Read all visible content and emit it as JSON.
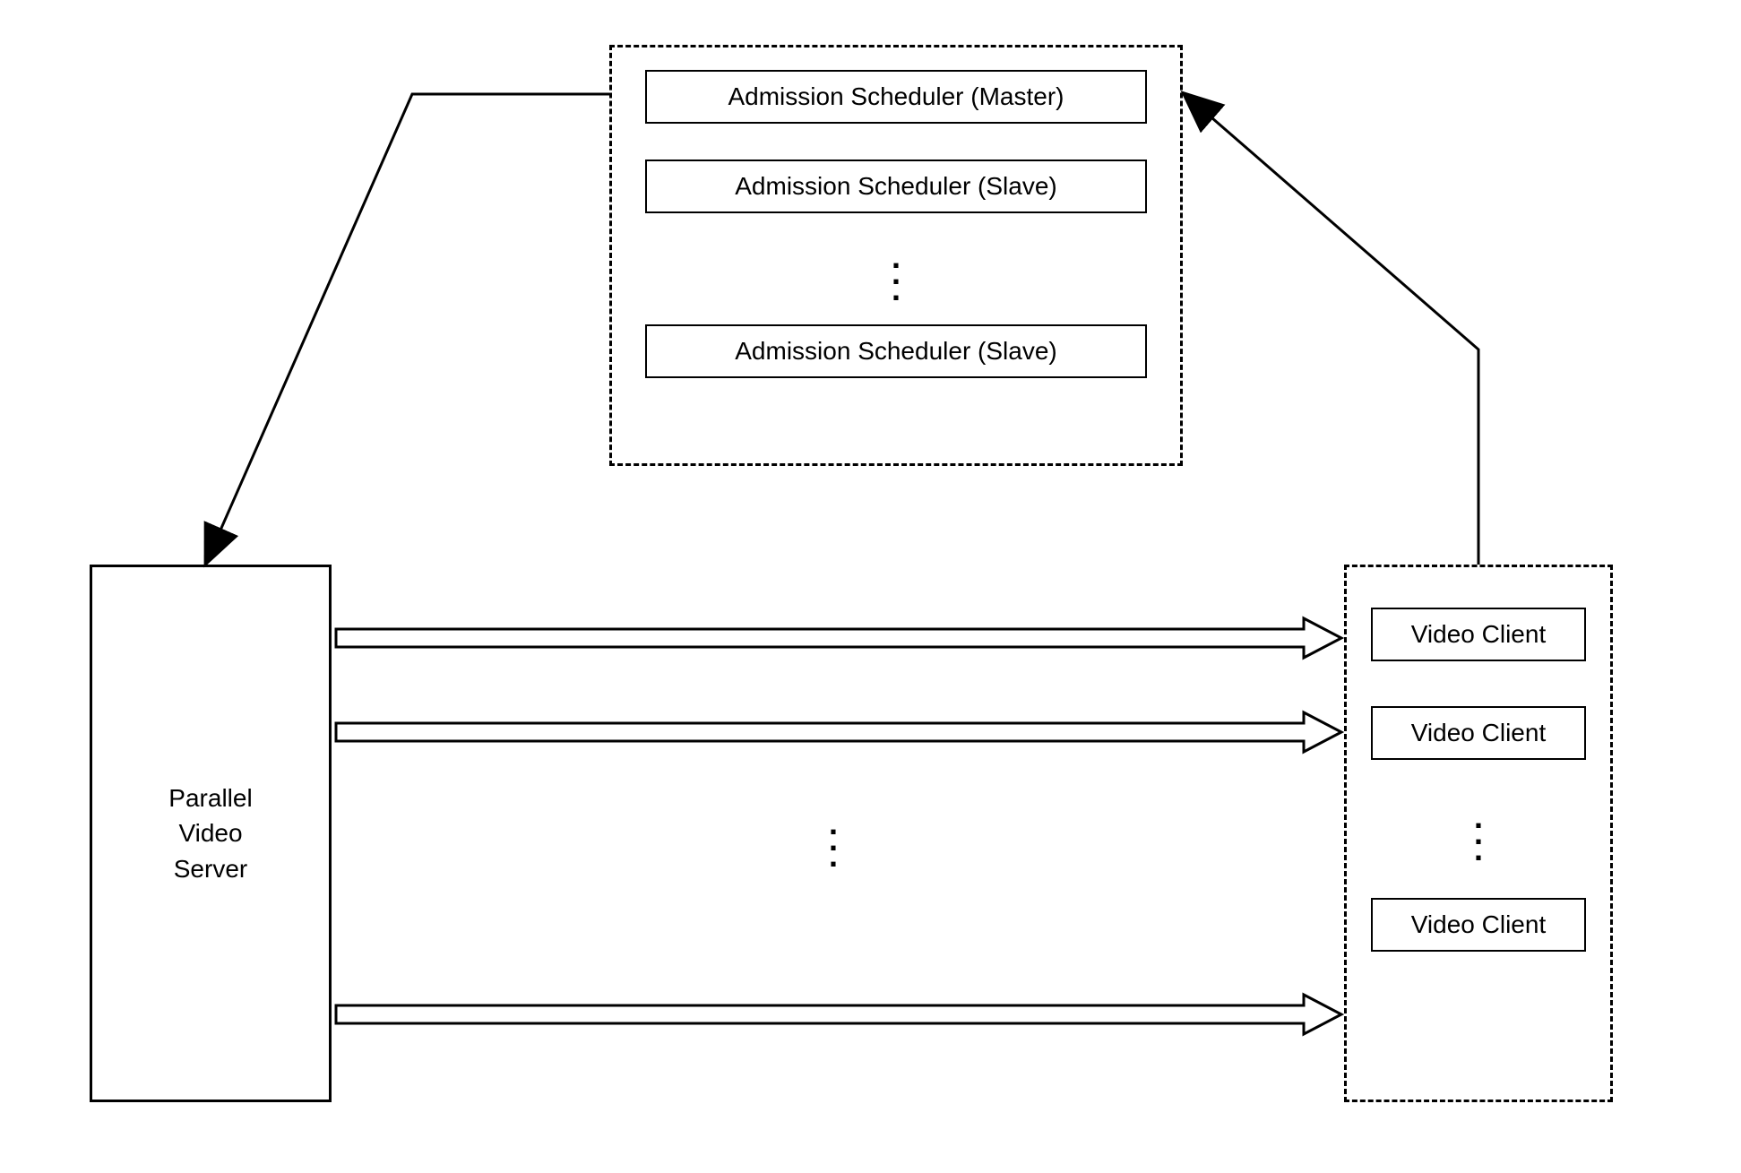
{
  "schedulers": {
    "master": "Admission Scheduler (Master)",
    "slave1": "Admission Scheduler (Slave)",
    "slave2": "Admission Scheduler (Slave)"
  },
  "server": {
    "label": "Parallel\nVideo\nServer"
  },
  "clients": {
    "c1": "Video Client",
    "c2": "Video Client",
    "c3": "Video Client"
  }
}
